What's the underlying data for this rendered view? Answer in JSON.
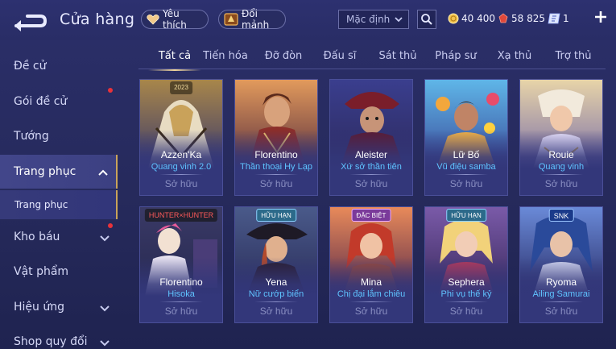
{
  "header": {
    "title": "Cửa hàng",
    "favorites_label": "Yêu thích",
    "shard_label": "Đổi mảnh",
    "sort_value": "Mặc định",
    "gold": "40 400",
    "ruby": "58 825",
    "ticket": "1"
  },
  "sidebar": {
    "items": [
      {
        "label": "Đề cử"
      },
      {
        "label": "Gói đề cử"
      },
      {
        "label": "Tướng"
      },
      {
        "label": "Trang phục"
      },
      {
        "label": "Trang phục"
      },
      {
        "label": "Kho báu"
      },
      {
        "label": "Vật phẩm"
      },
      {
        "label": "Hiệu ứng"
      },
      {
        "label": "Shop quy đổi"
      }
    ]
  },
  "tabs": [
    {
      "label": "Tất cả"
    },
    {
      "label": "Tiến hóa"
    },
    {
      "label": "Đỡ đòn"
    },
    {
      "label": "Đấu sĩ"
    },
    {
      "label": "Sát thủ"
    },
    {
      "label": "Pháp sư"
    },
    {
      "label": "Xạ thủ"
    },
    {
      "label": "Trợ thủ"
    }
  ],
  "cards": [
    {
      "hero": "Azzen'Ka",
      "skin": "Quang vinh 2.0",
      "status": "Sở hữu",
      "badge": "2023"
    },
    {
      "hero": "Florentino",
      "skin": "Thần thoại Hy Lạp",
      "status": "Sở hữu"
    },
    {
      "hero": "Aleister",
      "skin": "Xứ sở thần tiên",
      "status": "Sở hữu"
    },
    {
      "hero": "Lữ Bố",
      "skin": "Vũ điệu samba",
      "status": "Sở hữu"
    },
    {
      "hero": "Rouie",
      "skin": "Quang vinh",
      "status": "Sở hữu"
    },
    {
      "hero": "Florentino",
      "skin": "Hisoka",
      "status": "Sở hữu",
      "badge": "HUNTER×HUNTER"
    },
    {
      "hero": "Yena",
      "skin": "Nữ cướp biển",
      "status": "Sở hữu",
      "badge": "HỮU HẠN"
    },
    {
      "hero": "Mina",
      "skin": "Chị đại lắm chiêu",
      "status": "Sở hữu",
      "badge": "ĐẶC BIỆT"
    },
    {
      "hero": "Sephera",
      "skin": "Phi vụ thế kỷ",
      "status": "Sở hữu",
      "badge": "HỮU HẠN"
    },
    {
      "hero": "Ryoma",
      "skin": "Ailing Samurai",
      "status": "Sở hữu",
      "badge": "SNK"
    }
  ],
  "colors": {
    "background": "#2b2f6a",
    "skin_name": "#5fc3ff",
    "active_accent": "#c9a35a",
    "notification": "#e8323a"
  }
}
